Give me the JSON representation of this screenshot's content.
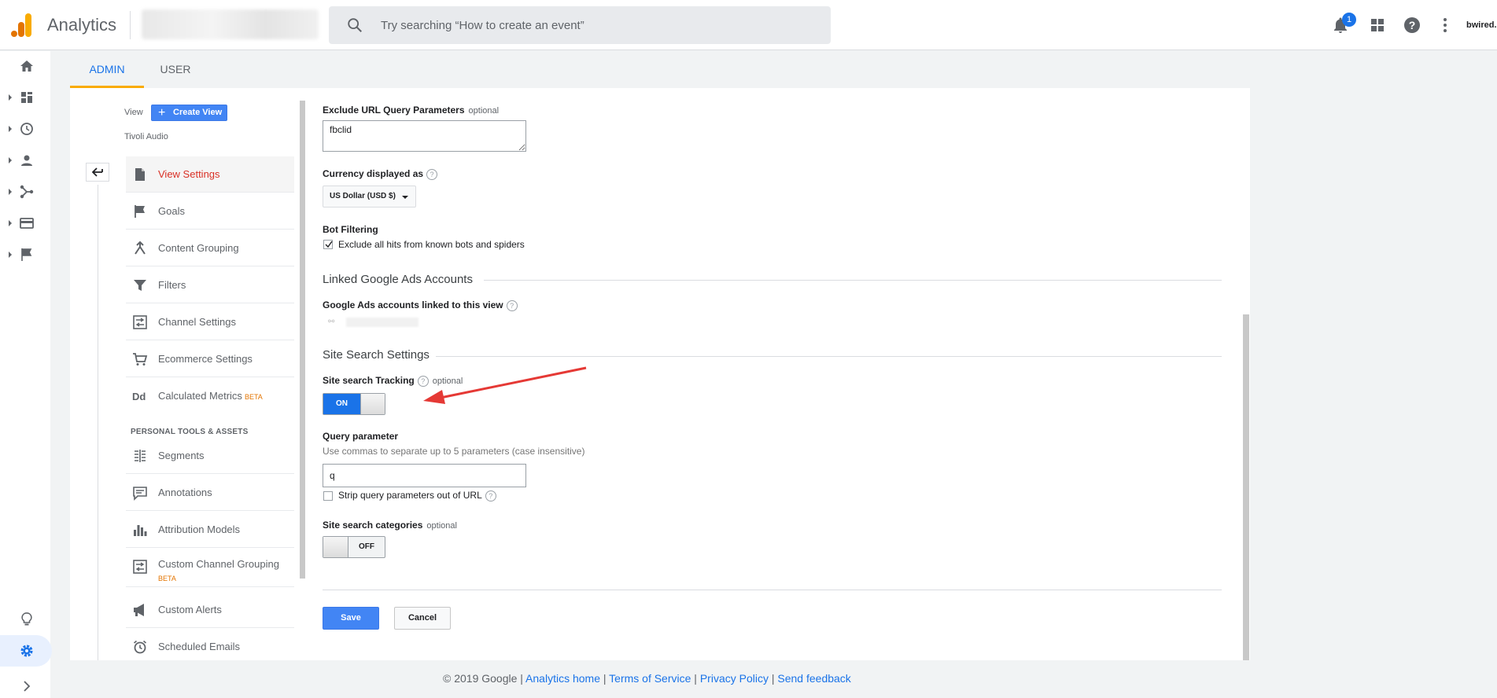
{
  "app": {
    "title": "Analytics"
  },
  "search": {
    "placeholder": "Try searching “How to create an event”"
  },
  "header": {
    "notification_count": "1",
    "user": "bwired."
  },
  "tabs": [
    {
      "label": "ADMIN"
    },
    {
      "label": "USER"
    }
  ],
  "sidebar": {
    "view_label": "View",
    "create_view_label": "Create View",
    "property_name": "Tivoli Audio",
    "items": [
      {
        "label": "View Settings"
      },
      {
        "label": "Goals"
      },
      {
        "label": "Content Grouping"
      },
      {
        "label": "Filters"
      },
      {
        "label": "Channel Settings"
      },
      {
        "label": "Ecommerce Settings"
      },
      {
        "label": "Calculated Metrics",
        "badge": "BETA"
      }
    ],
    "section_title": "PERSONAL TOOLS & ASSETS",
    "personal_items": [
      {
        "label": "Segments"
      },
      {
        "label": "Annotations"
      },
      {
        "label": "Attribution Models"
      },
      {
        "label": "Custom Channel Grouping",
        "badge": "BETA"
      },
      {
        "label": "Custom Alerts"
      },
      {
        "label": "Scheduled Emails"
      }
    ]
  },
  "form": {
    "exclude_label": "Exclude URL Query Parameters",
    "optional": "optional",
    "exclude_value": "fbclid",
    "currency_label": "Currency displayed as",
    "currency_value": "US Dollar (USD $)",
    "bot_label": "Bot Filtering",
    "bot_checkbox_label": "Exclude all hits from known bots and spiders",
    "bot_checked": true,
    "linked_section": "Linked Google Ads Accounts",
    "linked_label": "Google Ads accounts linked to this view",
    "site_search_section": "Site Search Settings",
    "site_search_label": "Site search Tracking",
    "site_search_toggle": "ON",
    "query_label": "Query parameter",
    "query_help": "Use commas to separate up to 5 parameters (case insensitive)",
    "query_value": "q",
    "strip_label": "Strip query parameters out of URL",
    "strip_checked": false,
    "categories_label": "Site search categories",
    "categories_toggle": "OFF",
    "save_label": "Save",
    "cancel_label": "Cancel"
  },
  "footer": {
    "copyright": "© 2019 Google",
    "separator": "|",
    "links": [
      "Analytics home",
      "Terms of Service",
      "Privacy Policy",
      "Send feedback"
    ]
  },
  "colors": {
    "accent": "#1a73e8",
    "active_item": "#d93025",
    "tab_underline": "#f9ab00",
    "annotation_arrow": "#e53935"
  }
}
